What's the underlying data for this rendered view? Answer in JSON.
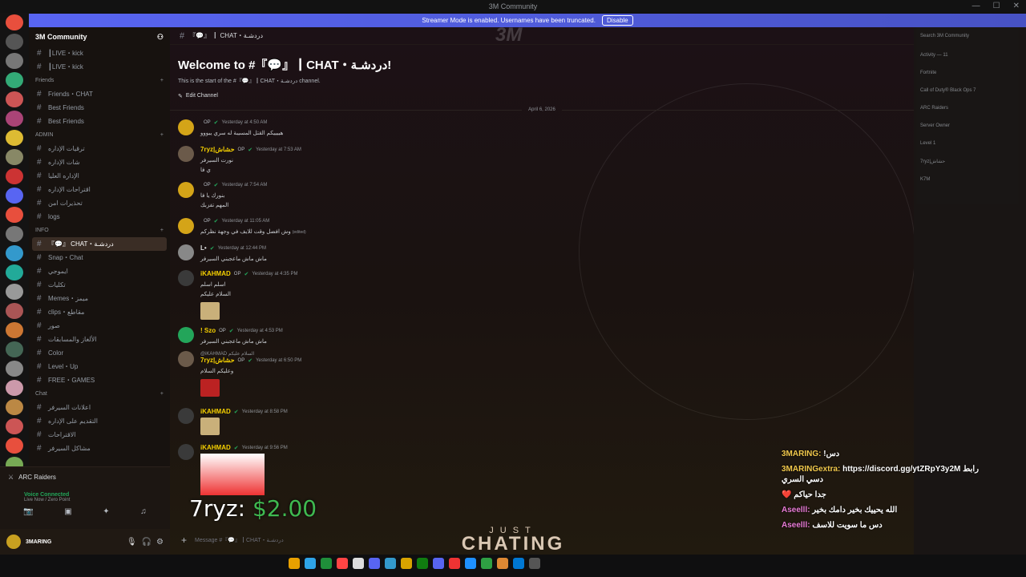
{
  "window": {
    "title": "3M Community"
  },
  "banner": {
    "text": "Streamer Mode is enabled. Usernames have been truncated.",
    "button": "Disable"
  },
  "guild": {
    "name": "3M Community"
  },
  "channels": [
    {
      "type": "ch",
      "label": "┃LIVE・kick"
    },
    {
      "type": "ch",
      "label": "┃LIVE・kick"
    },
    {
      "type": "cat",
      "label": "Friends"
    },
    {
      "type": "ch",
      "label": "Friends・CHAT"
    },
    {
      "type": "ch",
      "label": "Best Friends"
    },
    {
      "type": "ch",
      "label": "Best Friends"
    },
    {
      "type": "cat",
      "label": "ADMIN"
    },
    {
      "type": "ch",
      "label": "ترقيات الإداره"
    },
    {
      "type": "ch",
      "label": "شات الإداره"
    },
    {
      "type": "ch",
      "label": "الإداره العليا"
    },
    {
      "type": "ch",
      "label": "اقتراحات الإداره"
    },
    {
      "type": "ch",
      "label": "تحذيرات امن"
    },
    {
      "type": "ch",
      "label": "logs"
    },
    {
      "type": "cat",
      "label": "INFO"
    },
    {
      "type": "ch",
      "label": "『💬』 CHAT・دردشـة",
      "active": true
    },
    {
      "type": "ch",
      "label": "Snap・Chat"
    },
    {
      "type": "ch",
      "label": "ايموجي"
    },
    {
      "type": "ch",
      "label": "تكليات"
    },
    {
      "type": "ch",
      "label": "Memes・ميمز"
    },
    {
      "type": "ch",
      "label": "clips・مقاطع"
    },
    {
      "type": "ch",
      "label": "صور"
    },
    {
      "type": "ch",
      "label": "الألغاز والمسابقات"
    },
    {
      "type": "ch",
      "label": "Color"
    },
    {
      "type": "ch",
      "label": "Level・Up"
    },
    {
      "type": "ch",
      "label": "FREE・GAMES"
    },
    {
      "type": "cat",
      "label": "Chat"
    },
    {
      "type": "ch",
      "label": "اعلانات السيرفر"
    },
    {
      "type": "ch",
      "label": "التقديم على الإداره"
    },
    {
      "type": "ch",
      "label": "الاقتراحات"
    },
    {
      "type": "ch",
      "label": "مشاكل السيرفر"
    }
  ],
  "voice": {
    "server": "ARC Raiders",
    "status": "Voice Connected",
    "detail": "Live Now / Zero Point"
  },
  "user": {
    "name": "3MARING"
  },
  "header": {
    "channel": "『💬』 ┃ CHAT・دردشـة"
  },
  "welcome": {
    "title": "Welcome to #『💬』┃CHAT・دردشـة!",
    "subtitle": "This is the start of the #『💬』┃CHAT・دردشـة channel.",
    "edit": "Edit Channel",
    "date": "April 6, 2026"
  },
  "messages": [
    {
      "user": "",
      "badge": "OP",
      "time": "Yesterday at 4:50 AM",
      "text": "هييييكم القتل المسيبة له سري يبووو",
      "color": "#f0c000"
    },
    {
      "user": "7ryz|حشاش",
      "badge": "OP",
      "time": "Yesterday at 7:53 AM",
      "text": "نورت السيرفر",
      "text2": "ي فا",
      "color": "#f5d000"
    },
    {
      "user": "",
      "badge": "OP",
      "time": "Yesterday at 7:54 AM",
      "text": "بنورك يا فا",
      "text2": "المهم تفزبك",
      "color": "#f0c000"
    },
    {
      "user": "",
      "badge": "OP",
      "time": "Yesterday at 11:05 AM",
      "text": "وش افضل وقت للايف في وجهة نظركم",
      "edited": "(edited)",
      "color": "#f0c000"
    },
    {
      "user": "L•",
      "badge": "",
      "time": "Yesterday at 12:44 PM",
      "text": "ماش ماش ماعجبني السيرفر",
      "color": "#dcddde"
    },
    {
      "user": "iKAHMAD",
      "badge": "OP",
      "time": "Yesterday at 4:35 PM",
      "text": "اسلم اسلم",
      "text2": "السلام عليكم",
      "color": "#f5d000"
    },
    {
      "user": "! Szo",
      "badge": "OP",
      "time": "Yesterday at 4:53 PM",
      "text": "ماش ماش ماعجبني السيرفر",
      "color": "#f5d000"
    },
    {
      "user": "7ryz|حشاش",
      "badge": "OP",
      "time": "Yesterday at 6:50 PM",
      "reply": "@iKAHMAD السلام عليكم",
      "text": "وعليكم السلام",
      "color": "#f5d000"
    },
    {
      "user": "iKAHMAD",
      "badge": "",
      "time": "Yesterday at 8:58 PM",
      "text": "",
      "color": "#f5d000"
    },
    {
      "user": "iKAHMAD",
      "badge": "",
      "time": "Yesterday at 9:56 PM",
      "text": "",
      "color": "#f5d000"
    }
  ],
  "composer": {
    "placeholder": "Message #『💬』┃CHAT・دردشـة"
  },
  "rightpanel": {
    "search": "Search 3M Community",
    "activity": "Activity — 11",
    "items": [
      "Fortnite",
      "Call of Duty® Black Ops 7",
      "ARC Raiders",
      "Server Owner",
      "Level 1",
      "7ryz|حشاش",
      "K7M"
    ]
  },
  "overlay": {
    "lines": [
      {
        "name": "3MARING:",
        "text": "!دس"
      },
      {
        "name": "3MARINGextra:",
        "text": "https://discord.gg/ytZRpY3y2M رابط دسي السري"
      },
      {
        "name": "",
        "text": "❤️ جدا حياكم"
      },
      {
        "name": "Aseelll:",
        "text": "الله يحييك بخير دامك بخير"
      },
      {
        "name": "Aseelll:",
        "text": "دس ما سويت للاسف"
      }
    ]
  },
  "donation": {
    "name": "7ryz: ",
    "amount": "$2.00"
  },
  "stream": {
    "line1": "JUST",
    "line2": "CHATING"
  },
  "watermark": "3M"
}
